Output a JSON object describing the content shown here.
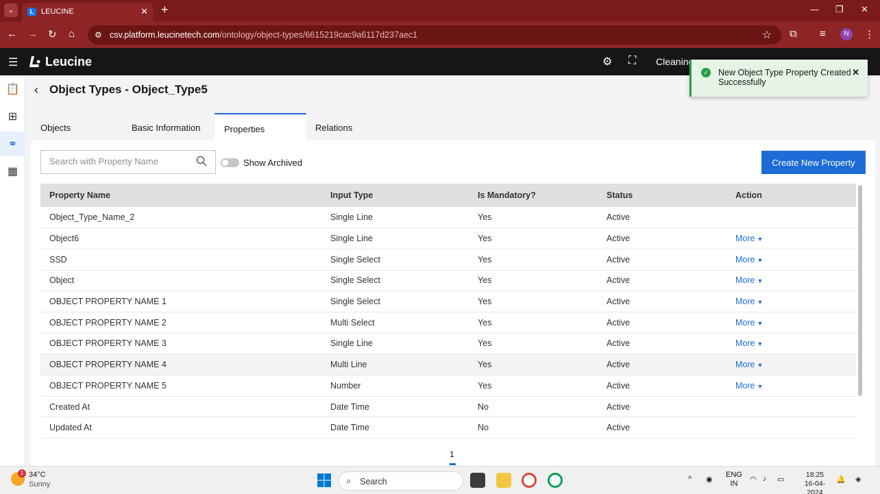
{
  "browser": {
    "tab_title": "LEUCINE",
    "url_host": "csv.platform.leucinetech.com",
    "url_path": "/ontology/object-types/6615219cac9a6117d237aec1",
    "profile_initial": "N"
  },
  "app": {
    "logo_text": "Leucine",
    "header_link": "Cleaning"
  },
  "page": {
    "title": "Object Types - Object_Type5",
    "tabs": [
      "Objects",
      "Basic Information",
      "Properties",
      "Relations"
    ],
    "active_tab": "Properties"
  },
  "toolbar": {
    "search_placeholder": "Search with Property Name",
    "show_archived_label": "Show Archived",
    "show_archived": false,
    "create_button_label": "Create New Property"
  },
  "table": {
    "headers": [
      "Property Name",
      "Input Type",
      "Is Mandatory?",
      "Status",
      "Action"
    ],
    "rows": [
      {
        "name": "Object_Type_Name_2",
        "input_type": "Single Line",
        "mandatory": "Yes",
        "status": "Active",
        "action": ""
      },
      {
        "name": "Object6",
        "input_type": "Single Line",
        "mandatory": "Yes",
        "status": "Active",
        "action": "More"
      },
      {
        "name": "SSD",
        "input_type": "Single Select",
        "mandatory": "Yes",
        "status": "Active",
        "action": "More"
      },
      {
        "name": "Object",
        "input_type": "Single Select",
        "mandatory": "Yes",
        "status": "Active",
        "action": "More"
      },
      {
        "name": "OBJECT PROPERTY NAME 1",
        "input_type": "Single Select",
        "mandatory": "Yes",
        "status": "Active",
        "action": "More"
      },
      {
        "name": "OBJECT PROPERTY NAME 2",
        "input_type": "Multi Select",
        "mandatory": "Yes",
        "status": "Active",
        "action": "More"
      },
      {
        "name": "OBJECT PROPERTY NAME 3",
        "input_type": "Single Line",
        "mandatory": "Yes",
        "status": "Active",
        "action": "More"
      },
      {
        "name": "OBJECT PROPERTY NAME 4",
        "input_type": "Multi Line",
        "mandatory": "Yes",
        "status": "Active",
        "action": "More"
      },
      {
        "name": "OBJECT PROPERTY NAME 5",
        "input_type": "Number",
        "mandatory": "Yes",
        "status": "Active",
        "action": "More"
      },
      {
        "name": "Created At",
        "input_type": "Date Time",
        "mandatory": "No",
        "status": "Active",
        "action": ""
      },
      {
        "name": "Updated At",
        "input_type": "Date Time",
        "mandatory": "No",
        "status": "Active",
        "action": ""
      }
    ]
  },
  "pagination": {
    "current_page": "1"
  },
  "toast": {
    "message": "New Object Type Property Created Successfully",
    "type": "success"
  },
  "taskbar": {
    "weather_temp": "34°C",
    "weather_desc": "Sunny",
    "weather_badge": "1",
    "search_label": "Search",
    "lang_line1": "ENG",
    "lang_line2": "IN",
    "time": "18:25",
    "date": "16-04-2024"
  },
  "colors": {
    "accent": "#1d6bd6",
    "browser_frame": "#8e2424",
    "success": "#24a148"
  }
}
